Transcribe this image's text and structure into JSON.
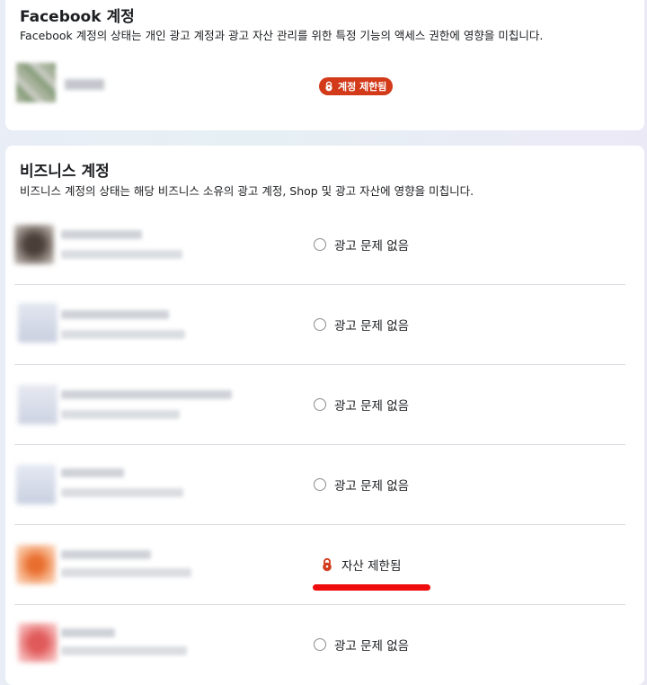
{
  "facebook_section": {
    "title": "Facebook 계정",
    "description": "Facebook 계정의 상태는 개인 광고 계정과 광고 자산 관리를 위한 특정 기능의 액세스 권한에 영향을 미칩니다.",
    "account": {
      "status_label": "계정 제한됨",
      "status_icon": "lock-icon",
      "badge_color": "#d23a1a"
    }
  },
  "business_section": {
    "title": "비즈니스 계정",
    "description": "비즈니스 계정의 상태는 해당 비즈니스 소유의 광고 계정, Shop 및 광고 자산에 영향을 미칩니다.",
    "rows": [
      {
        "status": "광고 문제 없음",
        "status_icon": "empty-circle-icon"
      },
      {
        "status": "광고 문제 없음",
        "status_icon": "empty-circle-icon"
      },
      {
        "status": "광고 문제 없음",
        "status_icon": "empty-circle-icon"
      },
      {
        "status": "광고 문제 없음",
        "status_icon": "empty-circle-icon"
      },
      {
        "status": "자산 제한됨",
        "status_icon": "lock-icon",
        "highlight_color": "#ee0c0c"
      },
      {
        "status": "광고 문제 없음",
        "status_icon": "empty-circle-icon"
      }
    ]
  }
}
